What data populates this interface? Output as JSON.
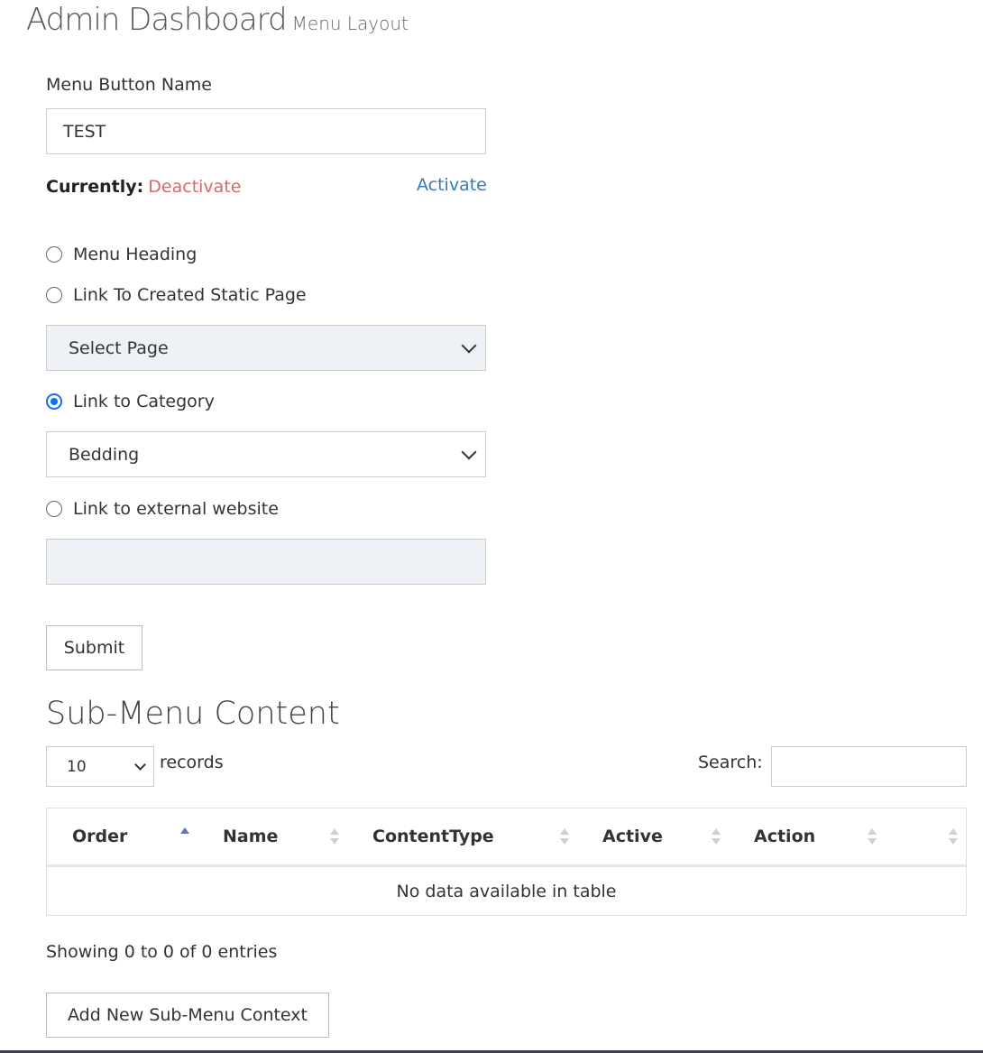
{
  "header": {
    "title": "Admin Dashboard",
    "subtitle": "Menu Layout"
  },
  "form": {
    "name_label": "Menu Button Name",
    "name_value": "TEST",
    "status_label": "Currently:",
    "status_value": "Deactivate",
    "status_color": "#e06666",
    "activate_link": "Activate",
    "options": [
      {
        "label": "Menu Heading",
        "checked": false
      },
      {
        "label": "Link To Created Static Page",
        "checked": false
      },
      {
        "label": "Link to Category",
        "checked": true
      },
      {
        "label": "Link to external website",
        "checked": false
      }
    ],
    "static_page_select": "Select Page",
    "category_select": "Bedding",
    "external_url_value": "",
    "submit_label": "Submit"
  },
  "submenu": {
    "title": "Sub-Menu Content",
    "page_length": "10",
    "records_label": "records",
    "search_label": "Search:",
    "search_value": "",
    "columns": [
      "Order",
      "Name",
      "ContentType",
      "Active",
      "Action",
      ""
    ],
    "sorted_column": "Order",
    "sort_direction": "asc",
    "empty_message": "No data available in table",
    "info": "Showing 0 to 0 of 0 entries",
    "add_button": "Add New Sub-Menu Context"
  },
  "colors": {
    "accent": "#0d6efd",
    "link": "#3a78b5",
    "disabled_bg": "#eef1f6"
  }
}
